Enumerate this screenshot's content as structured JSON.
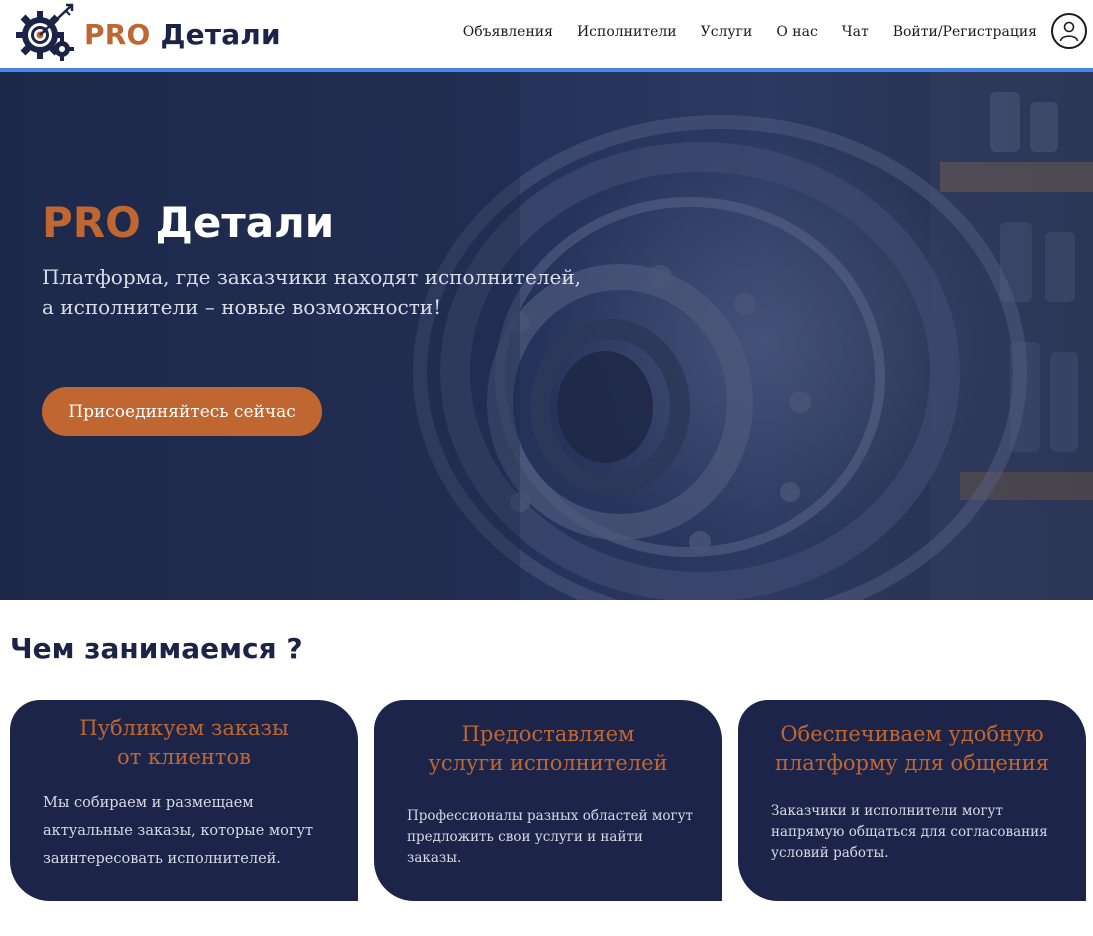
{
  "header": {
    "logo": {
      "pro": "PRO",
      "name": "Детали",
      "icon": "gear-target-arrow-logo"
    },
    "nav": [
      {
        "label": "Объявления"
      },
      {
        "label": "Исполнители"
      },
      {
        "label": "Услуги"
      },
      {
        "label": "О нас"
      },
      {
        "label": "Чат"
      },
      {
        "label": "Войти/Регистрация"
      }
    ],
    "user_icon": "user-icon"
  },
  "hero": {
    "title_pro": "PRO",
    "title_name": "Детали",
    "subtitle_line1": "Платформа, где заказчики находят исполнителей,",
    "subtitle_line2": "а исполнители – новые возможности!",
    "cta_label": "Присоединяйтесь сейчас"
  },
  "section": {
    "title": "Чем занимаемся ?",
    "cards": [
      {
        "title_lines": [
          "Публикуем заказы",
          "от клиентов"
        ],
        "text_lines": [
          "Мы собираем и размещаем",
          "актуальные заказы, которые могут",
          "заинтересовать исполнителей."
        ]
      },
      {
        "title_lines": [
          "Предоставляем",
          "услуги исполнителей"
        ],
        "text_lines": [
          "Профессионалы разных областей могут",
          "предложить свои услуги и найти",
          "заказы."
        ]
      },
      {
        "title_lines": [
          "Обеспечиваем удобную",
          "платформу для общения"
        ],
        "text_lines": [
          "Заказчики и исполнители могут",
          "напрямую общаться для согласования",
          "условий работы."
        ]
      }
    ]
  },
  "colors": {
    "accent": "#c06631",
    "navy": "#1c2549",
    "header_line": "#4a86e8"
  }
}
